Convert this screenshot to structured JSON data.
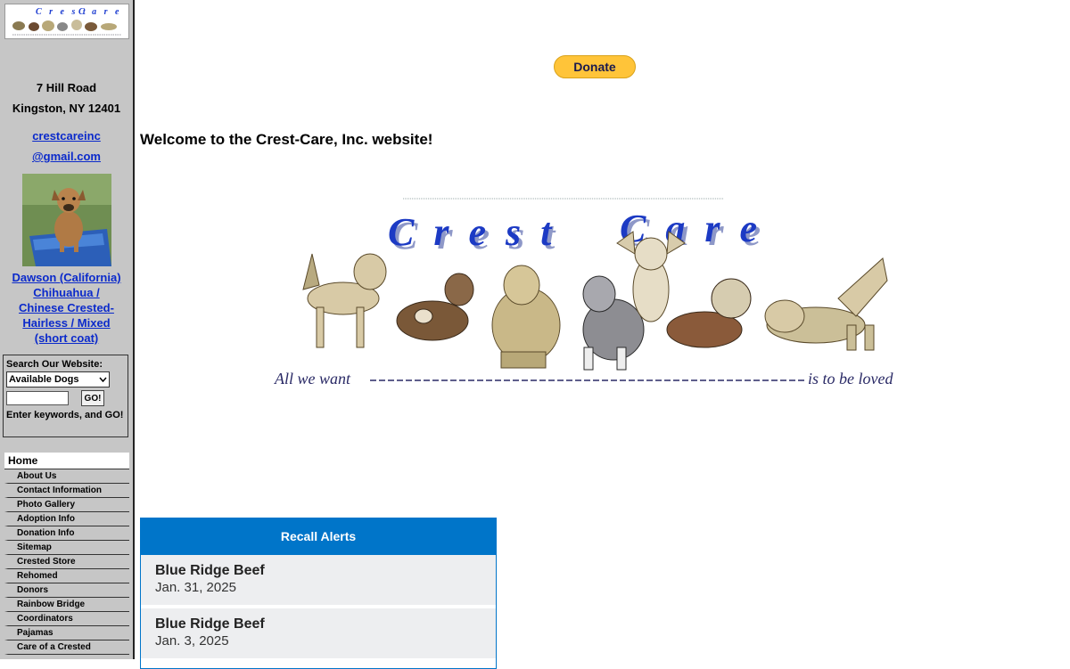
{
  "sidebar": {
    "address_line1": "7 Hill Road",
    "address_line2": "Kingston, NY 12401",
    "email_line1": "crestcareinc",
    "email_line2": "@gmail.com",
    "featured_dog_lines": [
      "Dawson (California)",
      "Chihuahua /",
      "Chinese Crested-",
      "Hairless / Mixed",
      "(short coat)"
    ],
    "search": {
      "label": "Search Our Website:",
      "select_value": "Available Dogs",
      "go_label": "GO!",
      "hint": "Enter keywords, and GO!"
    },
    "nav": {
      "home": "Home",
      "items": [
        "About Us",
        "Contact Information",
        "Photo Gallery",
        "Adoption Info",
        "Donation Info",
        "Sitemap",
        "Crested Store",
        "Rehomed",
        "Donors",
        "Rainbow Bridge",
        "Coordinators",
        "Pajamas",
        "Care of a Crested"
      ]
    }
  },
  "main": {
    "donate_label": "Donate",
    "welcome": "Welcome to the Crest-Care, Inc. website!",
    "banner": {
      "title_word1": "Crest",
      "title_word2": "Care",
      "tagline_left": "All we want",
      "tagline_right": "is to be loved"
    },
    "recall": {
      "header": "Recall Alerts",
      "entries": [
        {
          "title": "Blue Ridge Beef",
          "date": "Jan. 31, 2025"
        },
        {
          "title": "Blue Ridge Beef",
          "date": "Jan. 3, 2025"
        }
      ]
    }
  },
  "colors": {
    "sidebar_bg": "#c6c6c6",
    "link": "#0b2acb",
    "recall_blue": "#0075c9",
    "donate_yellow": "#ffc439"
  }
}
